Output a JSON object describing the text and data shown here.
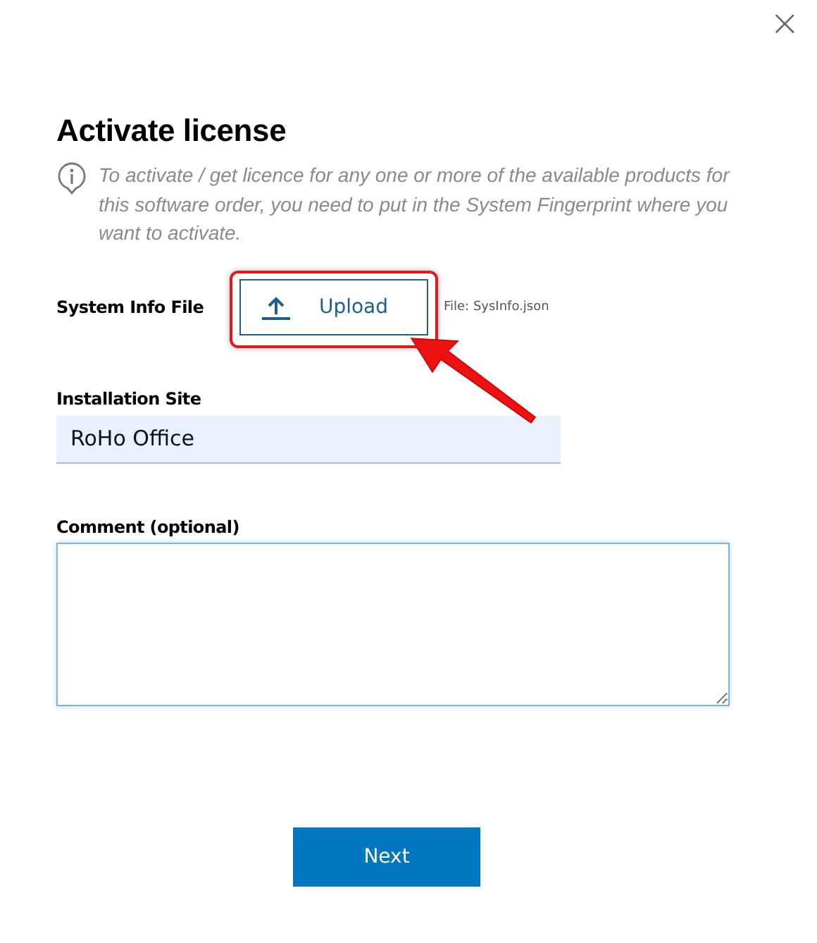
{
  "dialog": {
    "close_icon": "×",
    "title": "Activate license",
    "info": "To activate / get licence for any one or more of the available products for this software order, you need to put in the System Fingerprint where you want to activate."
  },
  "system_info_file": {
    "label": "System Info File",
    "button": "Upload",
    "file_name": "File: SysInfo.json"
  },
  "installation_site": {
    "label": "Installation Site",
    "value": "RoHo Office"
  },
  "comment": {
    "label": "Comment (optional)",
    "focused": true
  },
  "next_button": "Next",
  "annotations": [
    {
      "kind": "highlight"
    },
    {
      "kind": "arrow"
    }
  ]
}
